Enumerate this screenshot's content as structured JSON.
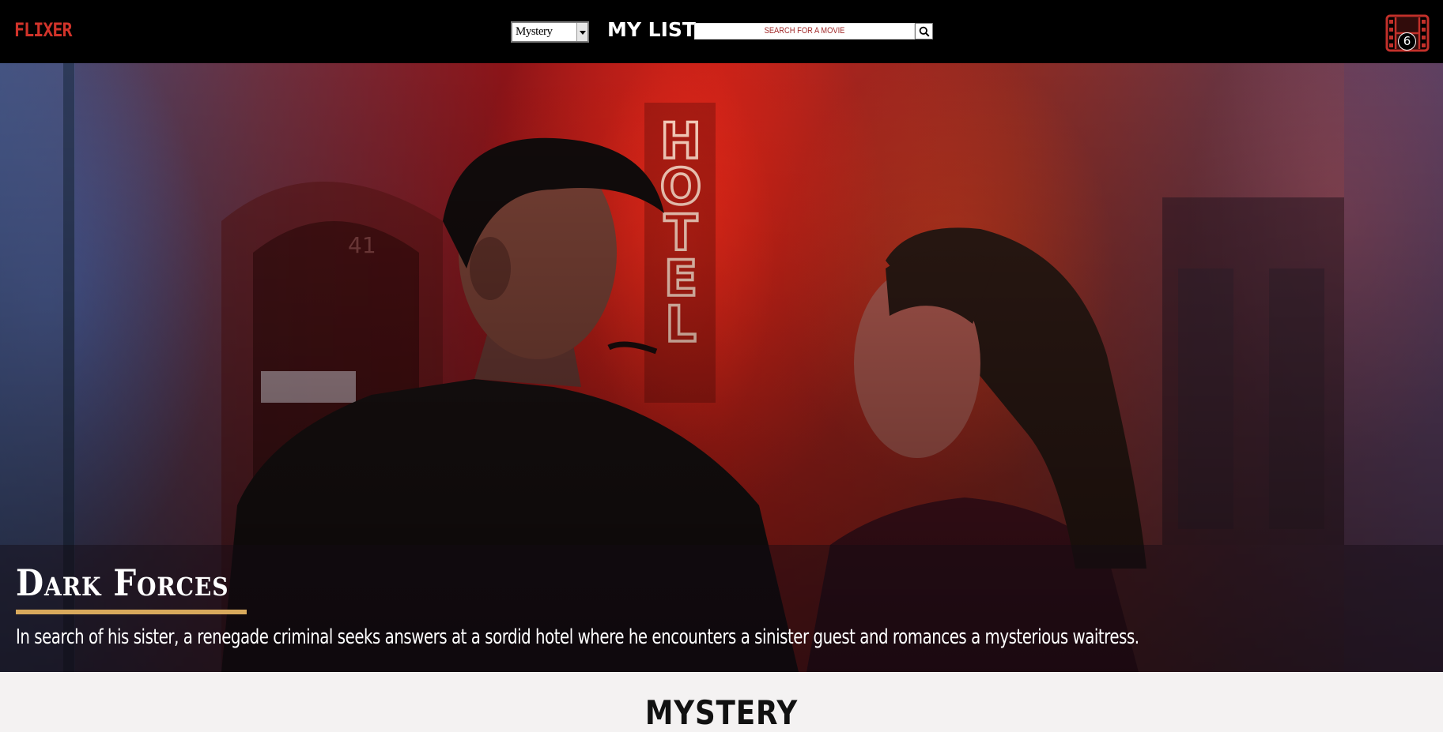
{
  "header": {
    "logo": "FLIXER",
    "genre_select": {
      "selected": "Mystery"
    },
    "my_list_label": "MY LIST",
    "search": {
      "placeholder": "SEARCH FOR A MOVIE"
    },
    "film_badge_count": "6"
  },
  "hero": {
    "title": "Dark Forces",
    "description": "In search of his sister, a renegade criminal seeks answers at a sordid hotel where he encounters a sinister guest and romances a mysterious waitress.",
    "sign_text": "HOTEL",
    "door_number": "41"
  },
  "section": {
    "title": "MYSTERY"
  },
  "colors": {
    "logo": "#d0332a",
    "accent_underline": "#d8a95c",
    "nav_background": "#000000",
    "search_text": "#a22b2b"
  },
  "icons": {
    "search": "magnifier-icon",
    "film": "film-strip-icon"
  }
}
